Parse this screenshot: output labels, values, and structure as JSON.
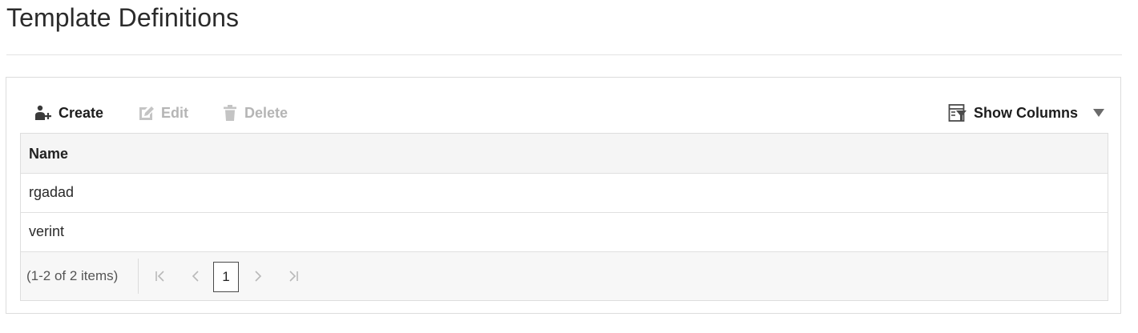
{
  "page": {
    "title": "Template Definitions"
  },
  "toolbar": {
    "create_label": "Create",
    "edit_label": "Edit",
    "delete_label": "Delete",
    "show_columns_label": "Show Columns"
  },
  "table": {
    "columns": [
      "Name"
    ],
    "rows": [
      {
        "name": "rgadad"
      },
      {
        "name": "verint"
      }
    ]
  },
  "pagination": {
    "summary": "(1-2 of 2 items)",
    "current_page": "1"
  },
  "icons": {
    "create": "add-user-icon",
    "edit": "pencil-icon",
    "delete": "trash-icon",
    "show_columns": "columns-filter-icon",
    "dropdown": "caret-down-icon",
    "first": "first-page-icon",
    "prev": "previous-page-icon",
    "next": "next-page-icon",
    "last": "last-page-icon"
  },
  "colors": {
    "text_primary": "#1d1d1d",
    "text_disabled": "#b5b5b5",
    "header_bg": "#f5f5f5",
    "border": "#dcdcdc"
  }
}
